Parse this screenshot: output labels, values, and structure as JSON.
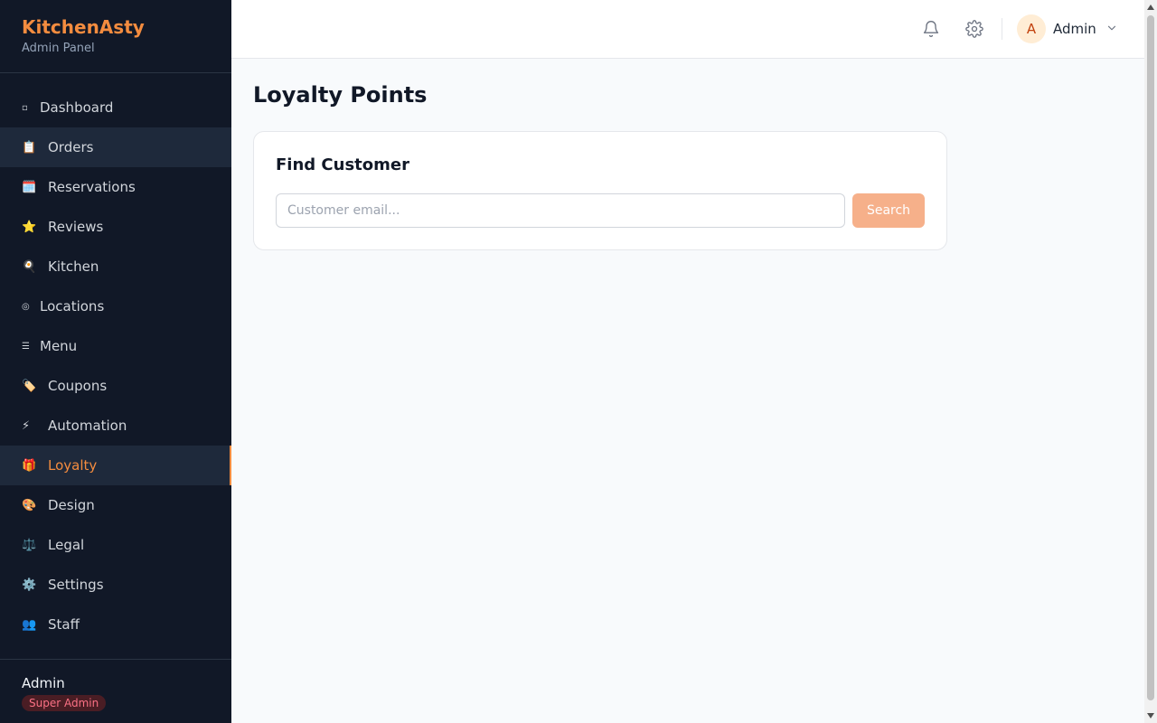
{
  "brand": {
    "title": "KitchenAsty",
    "subtitle": "Admin Panel"
  },
  "sidebar": {
    "items": [
      {
        "label": "Dashboard",
        "icon": "▫",
        "icon_name": "dashboard-icon"
      },
      {
        "label": "Orders",
        "icon": "📋",
        "icon_name": "clipboard-icon"
      },
      {
        "label": "Reservations",
        "icon": "🗓️",
        "icon_name": "calendar-icon"
      },
      {
        "label": "Reviews",
        "icon": "⭐",
        "icon_name": "star-icon"
      },
      {
        "label": "Kitchen",
        "icon": "🍳",
        "icon_name": "frying-pan-icon"
      },
      {
        "label": "Locations",
        "icon": "◎",
        "icon_name": "location-icon"
      },
      {
        "label": "Menu",
        "icon": "☰",
        "icon_name": "menu-list-icon"
      },
      {
        "label": "Coupons",
        "icon": "🏷️",
        "icon_name": "tag-icon"
      },
      {
        "label": "Automation",
        "icon": "⚡",
        "icon_name": "lightning-icon"
      },
      {
        "label": "Loyalty",
        "icon": "🎁",
        "icon_name": "gift-icon"
      },
      {
        "label": "Design",
        "icon": "🎨",
        "icon_name": "palette-icon"
      },
      {
        "label": "Legal",
        "icon": "⚖️",
        "icon_name": "scales-icon"
      },
      {
        "label": "Settings",
        "icon": "⚙️",
        "icon_name": "gear-icon"
      },
      {
        "label": "Staff",
        "icon": "👥",
        "icon_name": "people-icon"
      }
    ],
    "active_item": "Loyalty",
    "hovered_item": "Orders",
    "footer": {
      "name": "Admin",
      "role": "Super Admin"
    }
  },
  "topbar": {
    "user": {
      "initial": "A",
      "name": "Admin"
    }
  },
  "main": {
    "title": "Loyalty Points",
    "card": {
      "title": "Find Customer",
      "input_placeholder": "Customer email...",
      "input_value": "",
      "button_label": "Search"
    }
  },
  "colors": {
    "accent": "#f48c3f",
    "sidebar_bg": "#111827",
    "button_bg": "#f6b08a"
  }
}
